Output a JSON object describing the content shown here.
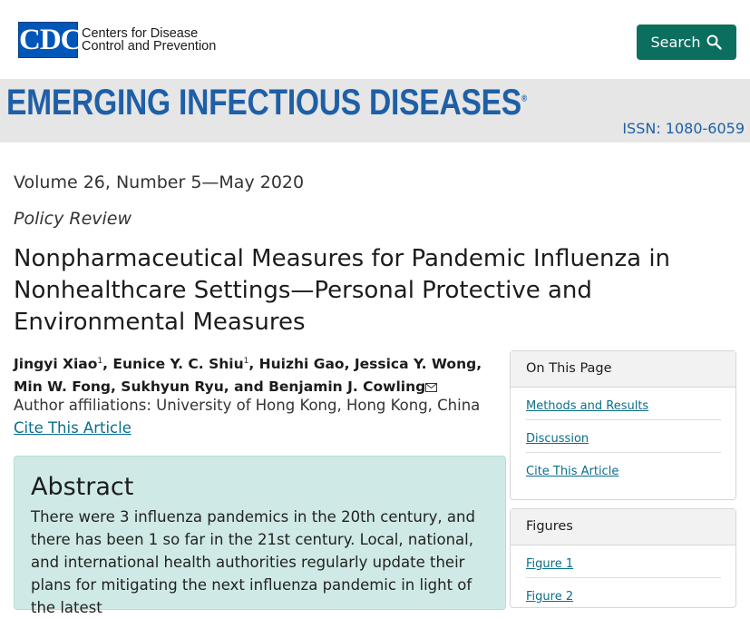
{
  "header": {
    "logo_mark": "CDC",
    "org_line1": "Centers for Disease",
    "org_line2": "Control and Prevention",
    "search_label": "Search",
    "search_icon": "search-icon"
  },
  "banner": {
    "journal_title": "EMERGING INFECTIOUS DISEASES",
    "registered": "®",
    "issn": "ISSN: 1080-6059"
  },
  "article": {
    "volume": "Volume 26, Number 5—May 2020",
    "section": "Policy Review",
    "title": "Nonpharmaceutical Measures for Pandemic Influenza in Nonhealthcare Settings—Personal Protective and Environmental Measures",
    "authors": {
      "a1": "Jingyi Xiao",
      "a1_sup": "1",
      "a2": ", Eunice Y. C. Shiu",
      "a2_sup": "1",
      "rest": ", Huizhi Gao, Jessica Y. Wong, Min W. Fong, Sukhyun Ryu, and Benjamin J. Cowling"
    },
    "affiliations": "Author affiliations: University of Hong Kong, Hong Kong, China",
    "cite_link": "Cite This Article"
  },
  "abstract": {
    "heading": "Abstract",
    "text": "There were 3 influenza pandemics in the 20th century, and there has been 1 so far in the 21st century. Local, national, and international health authorities regularly update their plans for mitigating the next influenza pandemic in light of the latest"
  },
  "sidebar": {
    "on_this_page": {
      "title": "On This Page",
      "items": [
        "Methods and Results",
        "Discussion",
        "Cite This Article"
      ]
    },
    "figures": {
      "title": "Figures",
      "items": [
        "Figure 1",
        "Figure 2"
      ]
    }
  },
  "colors": {
    "brand_blue": "#1f5fa6",
    "search_green": "#0b6e5f",
    "abstract_bg": "#cfeae6",
    "link": "#0b6e8a"
  }
}
